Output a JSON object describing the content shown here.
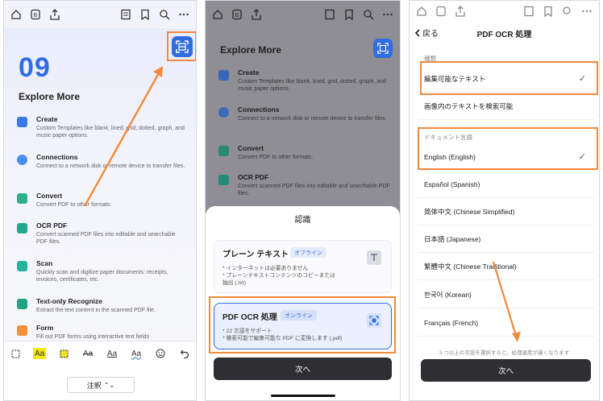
{
  "colors": {
    "accent": "#2f6de0",
    "highlight_frame": "#f08a3c",
    "button_dark": "#2f2f33"
  },
  "panel1": {
    "number": "09",
    "title": "Explore More",
    "features": [
      {
        "name": "Create",
        "desc": "Custom Templates like blank, lined, grid, dotted, graph, and music paper options.",
        "icon": "create-icon"
      },
      {
        "name": "Connections",
        "desc": "Connect to a network disk or remote device to transfer files.",
        "icon": "cloud-icon"
      },
      {
        "name": "Convert",
        "desc": "Convert PDF to other formats.",
        "icon": "convert-icon"
      },
      {
        "name": "OCR PDF",
        "desc": "Convert scanned PDF files into editable and searchable PDF files.",
        "icon": "ocr-pdf-icon"
      },
      {
        "name": "Scan",
        "desc": "Quickly scan and digitize paper documents: receipts, invoices, certificates, etc.",
        "icon": "scan-icon"
      },
      {
        "name": "Text-only Recognize",
        "desc": "Extract the text content in the scanned PDF file.",
        "icon": "text-recognize-icon"
      },
      {
        "name": "Form",
        "desc": "Fill out PDF forms using interactive text fields",
        "icon": "form-icon"
      }
    ],
    "annotation_tools": [
      "Aa",
      "Aa",
      "Aa",
      "Aa",
      "Aa"
    ],
    "annotation_select": "注釈"
  },
  "panel2": {
    "title": "Explore More",
    "features": [
      {
        "name": "Create",
        "desc": "Custom Templates like blank, lined, grid, dotted, graph, and music paper options."
      },
      {
        "name": "Connections",
        "desc": "Connect to a network disk or remote device to transfer files."
      },
      {
        "name": "Convert",
        "desc": "Convert PDF to other formats."
      },
      {
        "name": "OCR PDF",
        "desc": "Convert scanned PDF files into editable and searchable PDF files."
      }
    ],
    "sheet_title": "認識",
    "option_plain": {
      "title": "プレーン テキスト",
      "badge": "オフライン",
      "lines": [
        "* インターネットは必要ありません",
        "* プレーンテキストコンテンツのコピーまたは",
        "抽出 (.txt)"
      ]
    },
    "option_ocr": {
      "title": "PDF OCR 処理",
      "badge": "オンライン",
      "lines": [
        "* 22 言語をサポート",
        "* 検索可能で編集可能な PDF に変換します (.pdf)"
      ]
    },
    "next_label": "次へ"
  },
  "panel3": {
    "back_label": "戻る",
    "title": "PDF OCR 処理",
    "type_label": "種類",
    "type_options": [
      "編集可能なテキスト",
      "画像内のテキストを検索可能"
    ],
    "lang_label": "ドキュメント言語",
    "languages": [
      "English (English)",
      "Español (Spanish)",
      "简体中文 (Chinese Simplified)",
      "日本語 (Japanese)",
      "繁體中文 (Chinese Traditional)",
      "한국어 (Korean)",
      "Français (French)"
    ],
    "checkmark": "✓",
    "hint": "3 つ以上の言語を選択すると、処理速度が遅くなります",
    "next_label": "次へ"
  }
}
